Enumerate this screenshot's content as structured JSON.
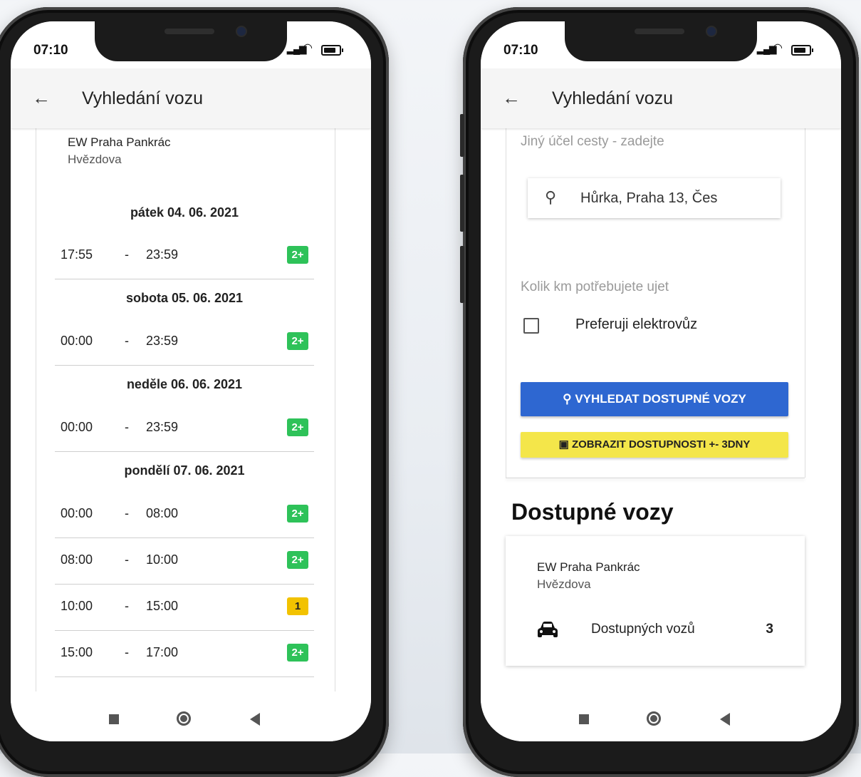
{
  "colors": {
    "badge_green": "#2ec259",
    "badge_yellow": "#f2c200",
    "button_blue": "#2e67d1",
    "button_yellow": "#f4e64a"
  },
  "left_phone": {
    "status": {
      "time": "07:10"
    },
    "appbar": {
      "back_icon": "arrow-left-icon",
      "title": "Vyhledání vozu"
    },
    "location": {
      "name": "EW Praha Pankrác",
      "street": "Hvězdova"
    },
    "days": [
      {
        "label": "pátek 04. 06. 2021",
        "slots": [
          {
            "from": "17:55",
            "sep": "-",
            "to": "23:59",
            "badge": "2+",
            "badge_color": "green"
          }
        ]
      },
      {
        "label": "sobota 05. 06. 2021",
        "slots": [
          {
            "from": "00:00",
            "sep": "-",
            "to": "23:59",
            "badge": "2+",
            "badge_color": "green"
          }
        ]
      },
      {
        "label": "neděle 06. 06. 2021",
        "slots": [
          {
            "from": "00:00",
            "sep": "-",
            "to": "23:59",
            "badge": "2+",
            "badge_color": "green"
          }
        ]
      },
      {
        "label": "pondělí 07. 06. 2021",
        "slots": [
          {
            "from": "00:00",
            "sep": "-",
            "to": "08:00",
            "badge": "2+",
            "badge_color": "green"
          },
          {
            "from": "08:00",
            "sep": "-",
            "to": "10:00",
            "badge": "2+",
            "badge_color": "green"
          },
          {
            "from": "10:00",
            "sep": "-",
            "to": "15:00",
            "badge": "1",
            "badge_color": "yellow"
          },
          {
            "from": "15:00",
            "sep": "-",
            "to": "17:00",
            "badge": "2+",
            "badge_color": "green"
          }
        ]
      }
    ]
  },
  "right_phone": {
    "status": {
      "time": "07:10"
    },
    "appbar": {
      "back_icon": "arrow-left-icon",
      "title": "Vyhledání vozu"
    },
    "form": {
      "purpose_placeholder": "Jiný účel cesty - zadejte",
      "address_value": "Hůrka, Praha 13, Čes",
      "km_placeholder": "Kolik km potřebujete ujet",
      "prefer_ev_label": "Preferuji elektrovůz",
      "prefer_ev_checked": false,
      "search_button": "VYHLEDAT DOSTUPNÉ VOZY",
      "availability_button": "ZOBRAZIT DOSTUPNOSTI +- 3DNY"
    },
    "results": {
      "title": "Dostupné vozy",
      "items": [
        {
          "name": "EW Praha Pankrác",
          "street": "Hvězdova",
          "label": "Dostupných vozů",
          "count": "3"
        }
      ]
    }
  }
}
